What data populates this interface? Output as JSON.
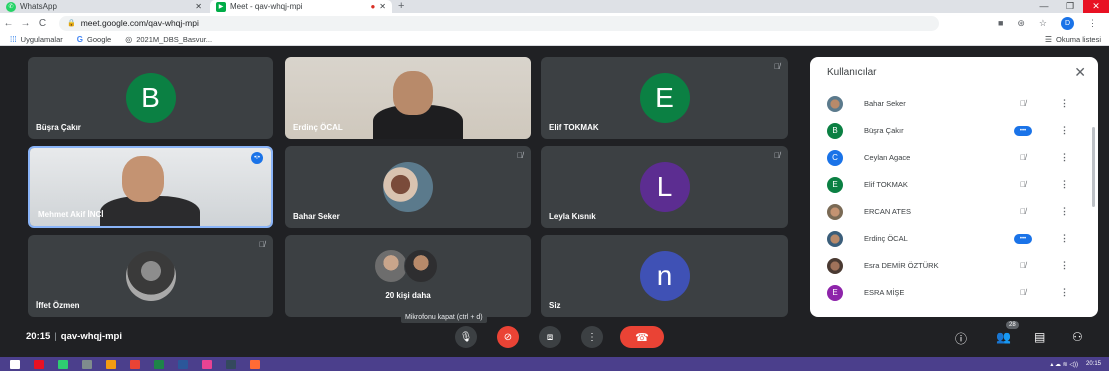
{
  "browser": {
    "tabs": [
      {
        "title": "WhatsApp",
        "active": false
      },
      {
        "title": "Meet - qav-whqj-mpi",
        "active": true
      }
    ],
    "url": "meet.google.com/qav-whqj-mpi",
    "profile_initial": "D",
    "bookmarks": [
      {
        "label": "Uygulamalar",
        "icon": "apps-grid-icon"
      },
      {
        "label": "Google",
        "icon": "google-icon"
      },
      {
        "label": "2021M_DBS_Basvur...",
        "icon": "globe-icon"
      }
    ],
    "reading_list": "Okuma listesi"
  },
  "tiles": [
    {
      "id": "busra",
      "name": "Büşra Çakır",
      "initial": "B",
      "color": "#0b8043",
      "type": "avatar",
      "muted": false
    },
    {
      "id": "erdinc",
      "name": "Erdinç ÖCAL",
      "type": "video",
      "muted": false
    },
    {
      "id": "elif",
      "name": "Elif TOKMAK",
      "initial": "E",
      "color": "#0b8043",
      "type": "avatar",
      "muted": true
    },
    {
      "id": "akif",
      "name": "Mehmet Akif İNCİ",
      "type": "video",
      "speaking": true
    },
    {
      "id": "bahar",
      "name": "Bahar Seker",
      "type": "photo",
      "muted": true
    },
    {
      "id": "leyla",
      "name": "Leyla Kısnık",
      "initial": "L",
      "color": "#5c2d91",
      "type": "avatar",
      "muted": true
    },
    {
      "id": "iffet",
      "name": "İffet Özmen",
      "type": "photo",
      "muted": true
    },
    {
      "id": "more",
      "label": "20 kişi daha",
      "type": "more"
    },
    {
      "id": "siz",
      "name": "Siz",
      "initial": "n",
      "color": "#3f51b5",
      "type": "avatar"
    }
  ],
  "panel": {
    "title": "Kullanıcılar",
    "participants": [
      {
        "name": "Bahar Seker",
        "type": "photo",
        "muted": true
      },
      {
        "name": "Büşra Çakır",
        "initial": "B",
        "color": "#0b8043",
        "speaking": true
      },
      {
        "name": "Ceylan Agace",
        "initial": "C",
        "color": "#1a73e8",
        "muted": true
      },
      {
        "name": "Elif TOKMAK",
        "initial": "E",
        "color": "#0b8043",
        "muted": true
      },
      {
        "name": "ERCAN ATES",
        "type": "photo",
        "muted": true
      },
      {
        "name": "Erdinç ÖCAL",
        "type": "photo",
        "speaking": true
      },
      {
        "name": "Esra DEMİR ÖZTÜRK",
        "type": "photo",
        "muted": true
      },
      {
        "name": "ESRA MİŞE",
        "initial": "E",
        "color": "#8e24aa",
        "muted": true
      }
    ]
  },
  "bottom": {
    "time": "20:15",
    "meeting_code": "qav-whqj-mpi",
    "tooltip": "Mikrofonu kapat (ctrl + d)",
    "participant_count": "28"
  },
  "taskbar": {
    "clock": "20:15"
  }
}
